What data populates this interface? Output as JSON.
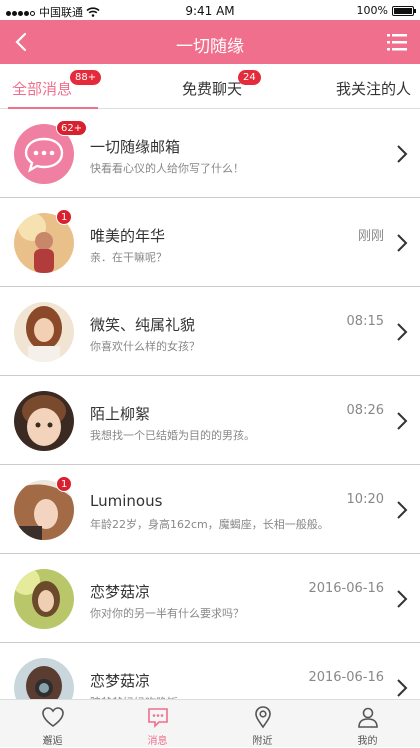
{
  "status_bar": {
    "carrier": "中国联通",
    "time": "9:41 AM",
    "battery": "100%"
  },
  "header": {
    "title": "一切随缘"
  },
  "tabs": [
    {
      "label": "全部消息",
      "badge": "88+"
    },
    {
      "label": "免费聊天",
      "badge": "24"
    },
    {
      "label": "我关注的人",
      "badge": ""
    }
  ],
  "conversations": [
    {
      "name": "一切随缘邮箱",
      "preview": "快看看心仪的人给你写了什么！",
      "time": "",
      "count": "62+"
    },
    {
      "name": "唯美的年华",
      "preview": "亲．在干嘛呢？",
      "time": "刚刚",
      "count": "1"
    },
    {
      "name": "微笑、纯属礼貌",
      "preview": "你喜欢什么样的女孩？",
      "time": "08:15",
      "count": ""
    },
    {
      "name": "陌上柳絮",
      "preview": "我想找一个已结婚为目的的男孩。",
      "time": "08:26",
      "count": ""
    },
    {
      "name": "Luminous",
      "preview": "年龄22岁，身高162cm，魔蝎座，长相一般般。",
      "time": "10:20",
      "count": "1"
    },
    {
      "name": "恋梦菇凉",
      "preview": "你对你的另一半有什么要求吗？",
      "time": "2016-06-16",
      "count": ""
    },
    {
      "name": "恋梦菇凉",
      "preview": "陪爸爸妈妈吃晚饭",
      "time": "2016-06-16",
      "count": ""
    }
  ],
  "bottom_nav": [
    {
      "label": "邂逅",
      "icon": "heart-icon"
    },
    {
      "label": "消息",
      "icon": "message-icon"
    },
    {
      "label": "附近",
      "icon": "location-icon"
    },
    {
      "label": "我的",
      "icon": "person-icon"
    }
  ],
  "colors": {
    "accent": "#ef6f8c",
    "badge": "#e52b3b"
  }
}
